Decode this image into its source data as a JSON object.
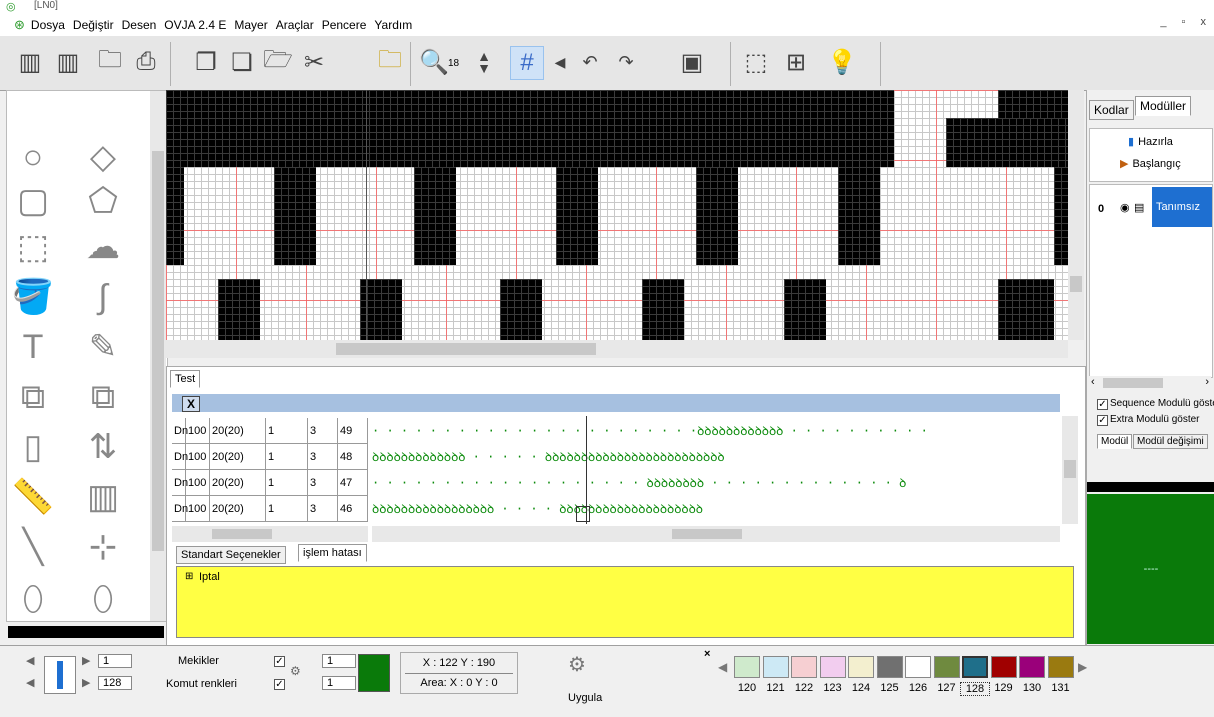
{
  "window": {
    "title": "[LN0]"
  },
  "menu": [
    "Dosya",
    "Değiştir",
    "Desen",
    "OVJA 2.4 E",
    "Mayer",
    "Araçlar",
    "Pencere",
    "Yardım"
  ],
  "toolbar": {
    "zoom_value": "18"
  },
  "right_panel": {
    "tabs": [
      "Kodlar",
      "Modüller"
    ],
    "actions": [
      "Hazırla",
      "Başlangıç"
    ],
    "module_index": "0",
    "module_name": "Tanımsız",
    "checks": [
      "Sequence Modulü göste",
      "Extra Modulü göster"
    ],
    "bottom_tabs": [
      "Modül",
      "Modül değişimi"
    ],
    "green_label": "----",
    "colors": {
      "selected": "#1e6fd1",
      "green": "#0a7a0a"
    }
  },
  "bottom": {
    "tab": "Test",
    "close_label": "X",
    "rows": [
      {
        "c0": "Dn",
        "c1": "100",
        "c2": "20(20)",
        "c3": "1",
        "c4": "3",
        "c5": "49",
        "stitches": "· · · · · · · · · · · · · · · · · ·  · · · · ·ꝺꝺꝺꝺꝺꝺꝺꝺꝺꝺꝺꝺ · · · · · · · · · ·"
      },
      {
        "c0": "Dn",
        "c1": "100",
        "c2": "20(20)",
        "c3": "1",
        "c4": "3",
        "c5": "48",
        "stitches": "ꝺꝺꝺꝺꝺꝺꝺꝺꝺꝺꝺꝺꝺ · · · · · ꝺꝺꝺꝺꝺꝺꝺꝺꝺꝺꝺꝺꝺꝺꝺꝺꝺꝺꝺꝺꝺꝺꝺꝺꝺ"
      },
      {
        "c0": "Dn",
        "c1": "100",
        "c2": "20(20)",
        "c3": "1",
        "c4": "3",
        "c5": "47",
        "stitches": "· · · · · · · · · · · · · · · · · · · ꝺꝺꝺꝺꝺꝺꝺꝺ · · · · · · · · · · · · · ꝺ"
      },
      {
        "c0": "Dn",
        "c1": "100",
        "c2": "20(20)",
        "c3": "1",
        "c4": "3",
        "c5": "46",
        "stitches": "ꝺꝺꝺꝺꝺꝺꝺꝺꝺꝺꝺꝺꝺꝺꝺꝺꝺ · · · · ꝺꝺꝺꝺꝺꝺꝺꝺꝺꝺꝺꝺꝺꝺꝺꝺꝺꝺꝺꝺ"
      }
    ],
    "subtabs": [
      "Standart Seçenekler",
      "işlem hatası"
    ],
    "tree_item": "Iptal",
    "tree_expander": "⊞"
  },
  "status": {
    "spin1": "1",
    "spin2": "128",
    "mekikler": "Mekikler",
    "komut": "Komut renkleri",
    "val1": "1",
    "val2": "1",
    "coords": "X : 122  Y : 190",
    "area": "Area: X : 0  Y : 0",
    "apply": "Uygula",
    "swatch_close": "×",
    "palette": [
      {
        "label": "120",
        "color": "#cfeacc"
      },
      {
        "label": "121",
        "color": "#cde9f5"
      },
      {
        "label": "122",
        "color": "#f6cfd2"
      },
      {
        "label": "123",
        "color": "#f2cdef"
      },
      {
        "label": "124",
        "color": "#f3efcf"
      },
      {
        "label": "125",
        "color": "#707070"
      },
      {
        "label": "126",
        "color": "#ffffff"
      },
      {
        "label": "127",
        "color": "#6f8a3f"
      },
      {
        "label": "128",
        "color": "#1f6f8a"
      },
      {
        "label": "129",
        "color": "#a00000"
      },
      {
        "label": "130",
        "color": "#9a007a"
      },
      {
        "label": "131",
        "color": "#9a7a10"
      }
    ],
    "color_block": "#0a7a0a"
  }
}
